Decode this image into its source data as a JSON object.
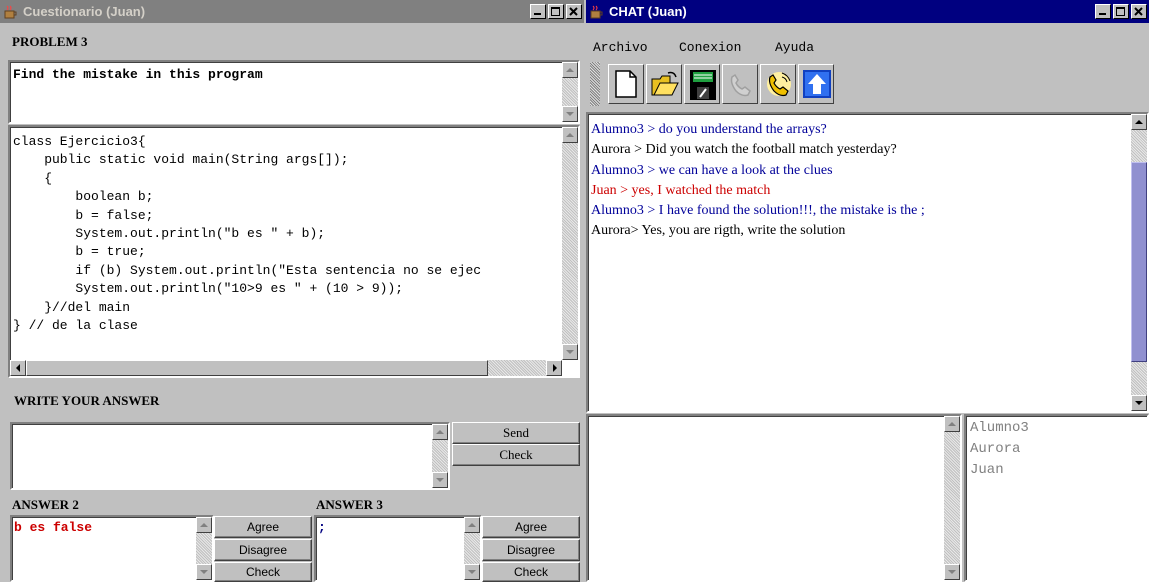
{
  "left_window": {
    "title": "Cuestionario (Juan)",
    "problem_label": "PROBLEM 3",
    "problem_text": "Find the mistake in this program",
    "code_lines": [
      "class Ejercicio3{",
      "    public static void main(String args[]);",
      "    {",
      "        boolean b;",
      "        b = false;",
      "        System.out.println(\"b es \" + b);",
      "        b = true;",
      "        if (b) System.out.println(\"Esta sentencia no se ejec",
      "        System.out.println(\"10>9 es \" + (10 > 9));",
      "    }//del main",
      "} // de la clase"
    ],
    "write_answer_label": "WRITE YOUR  ANSWER",
    "answer_input": "",
    "send_label": "Send",
    "check_label": "Check",
    "answer2": {
      "label": "ANSWER 2",
      "text": "b es false",
      "text_color": "#cc0000",
      "agree": "Agree",
      "disagree": "Disagree",
      "check": "Check"
    },
    "answer3": {
      "label": "ANSWER 3",
      "text": ";",
      "text_color": "#000080",
      "agree": "Agree",
      "disagree": "Disagree",
      "check": "Check"
    }
  },
  "right_window": {
    "title": "CHAT (Juan)",
    "menu": [
      "Archivo",
      "Conexion",
      "Ayuda"
    ],
    "toolbar_icons": [
      "new-document-icon",
      "open-folder-icon",
      "save-disk-icon",
      "phone-disabled-icon",
      "phone-connect-icon",
      "upload-arrow-icon"
    ],
    "messages": [
      {
        "text": "Alumno3 > do you understand the arrays?",
        "color": "#000099"
      },
      {
        "text": "Aurora > Did you watch the football match yesterday?",
        "color": "#000000"
      },
      {
        "text": "Alumno3 > we can have a look at the clues",
        "color": "#000099"
      },
      {
        "text": "Juan > yes, I watched the match",
        "color": "#cc0000"
      },
      {
        "text": "Alumno3 > I have found the solution!!!, the mistake is the ;",
        "color": "#000099"
      },
      {
        "text": "Aurora> Yes, you are rigth, write the solution",
        "color": "#000000"
      }
    ],
    "users": [
      "Alumno3",
      "Aurora",
      "Juan"
    ]
  }
}
